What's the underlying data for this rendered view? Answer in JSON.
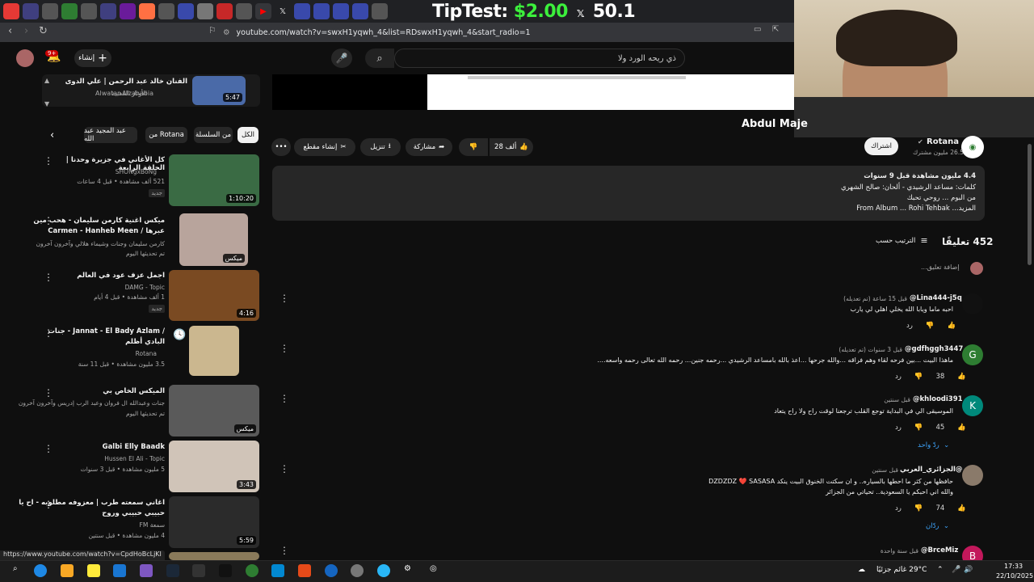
{
  "browser": {
    "url": "youtube.com/watch?v=swxH1yqwh_4&list=RDswxH1yqwh_4&start_radio=1",
    "status_url": "https://www.youtube.com/watch?v=CpdHoBcLjKI"
  },
  "overlay": {
    "tip_label": "TipTest:",
    "amount1": "$2.00",
    "amount2": "50.1"
  },
  "header": {
    "search_query": "ذي ريحه الورد ولا",
    "create_label": "إنشاء",
    "notif_count": "9+"
  },
  "now_playing": {
    "title": "الفنان خالد عبد الرحمن | علي الدوى",
    "channel": "Alwatar Alzahabia",
    "note": "الأوتار الذهبية",
    "duration": "5:47"
  },
  "chips": {
    "all": "الكل",
    "series": "من السلسلة",
    "rotana": "من Rotana",
    "abdulmajeed": "عبد المجيد عبد الله"
  },
  "video": {
    "title_partial": "Abdul Maje",
    "channel": "Rotana",
    "subscribers": "26.5 مليون مشترك",
    "subscribe_label": "اشتراك",
    "likes": "28 ألف",
    "share_label": "مشاركة",
    "download_label": "تنزيل",
    "clip_label": "إنشاء مقطع"
  },
  "description": {
    "line1": "4.4 مليون مشاهدة قبل 9 سنوات",
    "line2": "كلمات: مساعد الرشيدي - ألحان: صالح الشهري",
    "line3": "من البوم ... روحي تحبك",
    "line4": "From Album ... Rohi Tehbak ...المزيد"
  },
  "comments_header": {
    "count": "452 تعليقًا",
    "sort_label": "الترتيب حسب",
    "add_placeholder": "إضافة تعليق..."
  },
  "comments": [
    {
      "author": "@Lina444-j5q",
      "time": "قبل 15 ساعة (تم تعديله)",
      "text": "احبه ماما ويابا الله يخلي اهلي لي يارب",
      "likes": "",
      "reply": "رد",
      "avatar_letter": "",
      "avatar_color": "#111111"
    },
    {
      "author": "@gdfhggh3447",
      "time": "قبل 3 سنوات (تم تعديله)",
      "text": "ماهذا البيت ...بين فرحه لقاء وهم فراقه ...والله جرحها ...اعذ بالله بامساعد الرشيدي ...رحمه جنين... رحمه الله تعالى رحمه واسعه....",
      "likes": "38",
      "reply": "رد",
      "avatar_letter": "G",
      "avatar_color": "#2e7d32"
    },
    {
      "author": "@khloodi391",
      "time": "قبل سنتين",
      "text": "الموسيقى الي في البداية توجع القلب ترجعنا لوقت راح ولا راح يتعاد",
      "likes": "45",
      "reply": "رد",
      "avatar_letter": "K",
      "avatar_color": "#00897b",
      "replies": "ردّ واحد"
    },
    {
      "author": "@الجزائري_العربي",
      "time": "قبل سنتين",
      "text": "حافظها من كثر ما احطها بالسياره.. و ان سكتت الخنوق البيت ينكد DZDZDZ ❤️ SASASA",
      "text2": "والله اني احبكم يا السعودية.. تحياتي من الجزائر",
      "likes": "74",
      "reply": "رد",
      "avatar_letter": "",
      "avatar_color": "#8a7a6a",
      "replies": "ردّان"
    },
    {
      "author": "@BrceMiz",
      "time": "قبل سنة واحدة",
      "avatar_letter": "B",
      "avatar_color": "#c2185b"
    }
  ],
  "sidebar": [
    {
      "title": "كل الأغاني في جزيرة وحدنا | الحلقة الرابعة",
      "channel": "SHONgxBoNg",
      "meta": "521 ألف مشاهدة • قبل 4 ساعات",
      "badge": "جديد",
      "duration": "1:10:20",
      "thumb_color": "#3a6b44"
    },
    {
      "title": "ميكس اغنية كارمن سليمان - هحب مين",
      "title2": "Carmen - Hanheb Meen / عبرها",
      "channel": "كارمن سليمان وجنات وشيماء هلالي وآخرون آخرون",
      "meta": "تم تحديثها اليوم",
      "badge": "",
      "duration": "ميكس",
      "thumb_color": "#b8a49c"
    },
    {
      "title": "اجمل عزف عود في العالم",
      "channel": "DAMG - Topic",
      "meta": "1 ألف مشاهدة • قبل 4 أيام",
      "badge": "جديد",
      "duration": "4:16",
      "thumb_color": "#7a4a22"
    },
    {
      "title": "جنات - Jannat - El Bady Azlam /",
      "title2": "البادي أظلم",
      "channel": "Rotana",
      "meta": "3.5 مليون مشاهدة • قبل 11 سنة",
      "badge": "",
      "duration": "",
      "thumb_color": "#cbb78f"
    },
    {
      "title": "الميكس الخاص بي",
      "channel": "جنات وعبدالله ال فروان وعبد الرب إدريس وآخرون آخرون",
      "meta": "تم تحديثها اليوم",
      "badge": "",
      "duration": "ميكس",
      "thumb_color": "#5a5a5a"
    },
    {
      "title": "Galbi Elly Baadk",
      "channel": "Hussen El Ali - Topic",
      "meta": "5 مليون مشاهدة • قبل 3 سنوات",
      "badge": "",
      "duration": "3:43",
      "thumb_color": "#d0c4b8"
    },
    {
      "title": "اغاني سمعته طرب | معزوفه مطلوبه - اح يا",
      "title2": "حبيبي حبيبي وروح",
      "channel": "سمعة FM",
      "meta": "4 مليون مشاهدة • قبل سنتين",
      "badge": "",
      "duration": "5:59",
      "thumb_color": "#2b2b2b"
    }
  ],
  "taskbar": {
    "weather": "29°C غائم جزئيًا",
    "time": "17:33",
    "date": "22/10/2025"
  }
}
